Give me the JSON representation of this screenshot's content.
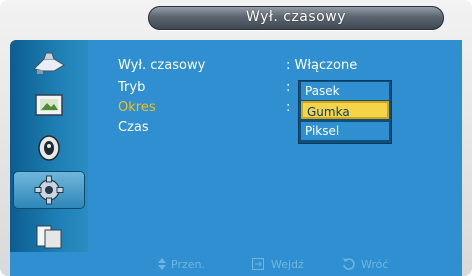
{
  "window": {
    "title": "Wył. czasowy"
  },
  "sidebar": {
    "items": [
      {
        "icon": "input-icon"
      },
      {
        "icon": "picture-icon"
      },
      {
        "icon": "sound-icon"
      },
      {
        "icon": "settings-icon"
      },
      {
        "icon": "multi-control-icon"
      }
    ],
    "active_index": 3
  },
  "menu": {
    "rows": [
      {
        "label": "Wył. czasowy",
        "value": ": Włączone"
      },
      {
        "label": "Tryb",
        "value": ":"
      },
      {
        "label": "Okres",
        "value": ":"
      },
      {
        "label": "Czas",
        "value": ""
      }
    ],
    "highlight_color": "#f0c020"
  },
  "dropdown": {
    "options": [
      "Pasek",
      "Gumka",
      "Piksel"
    ],
    "selected": "Gumka"
  },
  "footer": {
    "move_label": "Przen.",
    "enter_label": "Wejdź",
    "return_label": "Wróć"
  }
}
